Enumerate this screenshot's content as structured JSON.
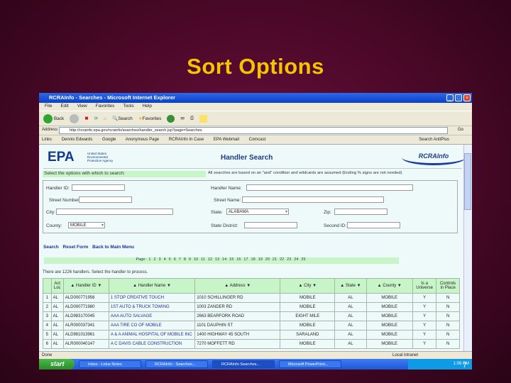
{
  "slide_title": "Sort Options",
  "window": {
    "title": "RCRAInfo - Searches - Microsoft Internet Explorer",
    "menu": [
      "File",
      "Edit",
      "View",
      "Favorites",
      "Tools",
      "Help"
    ],
    "toolbar": {
      "back": "Back",
      "search": "Search",
      "favorites": "Favorites"
    },
    "address_label": "Address",
    "address": "http://rcrainfo.epa.gov/rcrainfo/searches/handler_search.jsp?page=Searches",
    "go": "Go",
    "links_label": "Links",
    "links": [
      "Dennis Edwards",
      "Google",
      "Anonymous Page",
      "RCRAInfo In Case",
      "EPA Webmail",
      "Comcast"
    ],
    "search_toolbar": "Search AnttPlus"
  },
  "page": {
    "epa": "EPA",
    "epa_sub": "United States Environmental Protection Agency",
    "heading": "Handler Search",
    "rcra_logo": "RCRAInfo",
    "instr_left": "Select the options with which to search:",
    "instr_right": "All searches are based on an \"and\" condition and wildcards are assumed (Ending % signs are not needed)",
    "fields": {
      "handler_id": "Handler ID:",
      "handler_name": "Handler Name:",
      "street_number": "Street Number:",
      "street_name": "Street Name:",
      "city": "City:",
      "state": "State:",
      "state_value": "ALABAMA",
      "zip": "Zip:",
      "county": "County:",
      "county_value": "MOBILE",
      "state_district": "State District:",
      "second_id": "Second ID:"
    },
    "actions": [
      "Search",
      "Reset Form",
      "Back to Main Menu"
    ],
    "pager_label": "Page:",
    "pages": [
      "1",
      "2",
      "3",
      "4",
      "5",
      "6",
      "7",
      "8",
      "9",
      "10",
      "11",
      "12",
      "13",
      "14",
      "15",
      "16",
      "17",
      "18",
      "19",
      "20",
      "21",
      "22",
      "23",
      "24",
      "25"
    ],
    "result_count": "There are 1226 handlers. Select the handler to process.",
    "columns": [
      "",
      "Act Loc",
      "▲ Handler ID ▼",
      "▲ Handler Name ▼",
      "▲ Address ▼",
      "▲ City ▼",
      "▲ State ▼",
      "▲ County ▼",
      "Is a Universe",
      "Controls in Place"
    ],
    "rows": [
      [
        "1",
        "AL",
        "ALD000771956",
        "1 STOP CREATIVE TOUCH",
        "1010 SCHILLINGER RD",
        "MOBILE",
        "AL",
        "MOBILE",
        "Y",
        "N"
      ],
      [
        "2",
        "AL",
        "ALD000771980",
        "1ST AUTO & TRUCK TOWING",
        "1003 ZANDER RD",
        "MOBILE",
        "AL",
        "MOBILE",
        "Y",
        "N"
      ],
      [
        "3",
        "AL",
        "ALD983170045",
        "AAA AUTO SALVAGE",
        "2663 BEARFORK ROAD",
        "EIGHT MILE",
        "AL",
        "MOBILE",
        "Y",
        "N"
      ],
      [
        "4",
        "AL",
        "ALR000037341",
        "AAA TIRE CO OF MOBILE",
        "1101 DAUPHIN ST",
        "MOBILE",
        "AL",
        "MOBILE",
        "Y",
        "N"
      ],
      [
        "5",
        "AL",
        "ALD981013961",
        "A & A ANIMAL HOSPITAL OF MOBILE INC",
        "1400 HIGHWAY 45 SOUTH",
        "SARALAND",
        "AL",
        "MOBILE",
        "Y",
        "N"
      ],
      [
        "6",
        "AL",
        "ALR000040147",
        "A C DAVIS CABLE CONSTRUCTION",
        "7270 MOFFETT RD",
        "MOBILE",
        "AL",
        "MOBILE",
        "Y",
        "N"
      ]
    ],
    "row_links": [
      false,
      false,
      true,
      false,
      false,
      true
    ]
  },
  "status": {
    "left": "Done",
    "zone": "Local intranet"
  },
  "taskbar": {
    "start": "start",
    "items": [
      "Inbox - Lotus Notes",
      "RCRAInfo - Searches...",
      "RCRAInfo Searches...",
      "Microsoft PowerPoint..."
    ],
    "clock": "1:06 PM"
  },
  "slide_number": "7"
}
